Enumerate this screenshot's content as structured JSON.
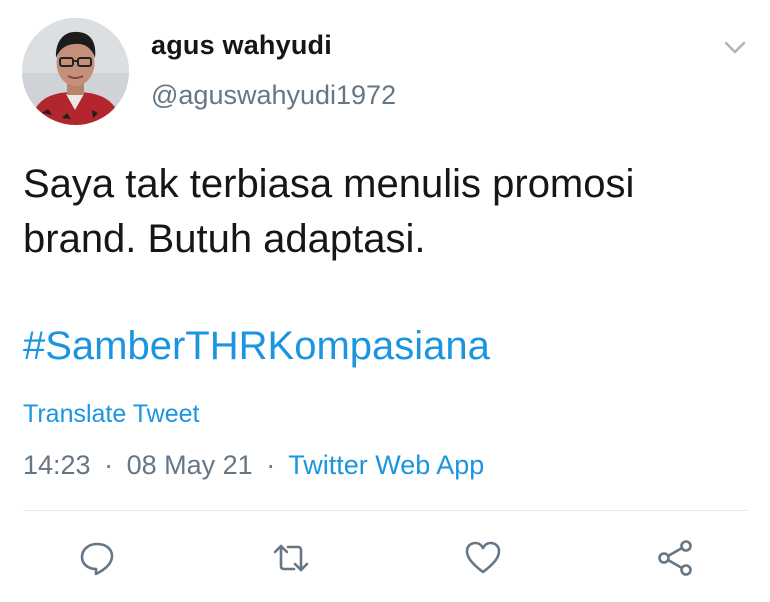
{
  "tweet": {
    "author": {
      "display_name": "agus wahyudi",
      "handle": "@aguswahyudi1972",
      "avatar_icon": "profile-photo"
    },
    "menu_icon": "chevron-down-icon",
    "body": "Saya tak terbiasa menulis promosi brand. Butuh adaptasi.",
    "hashtag": "#SamberTHRKompasiana",
    "translate_label": "Translate Tweet",
    "meta": {
      "time": "14:23",
      "separator": "·",
      "date": "08 May 21",
      "source": "Twitter Web App"
    },
    "actions": [
      {
        "name": "reply",
        "icon": "reply-icon"
      },
      {
        "name": "retweet",
        "icon": "retweet-icon"
      },
      {
        "name": "like",
        "icon": "heart-icon"
      },
      {
        "name": "share",
        "icon": "share-icon"
      }
    ]
  },
  "colors": {
    "text": "#14171a",
    "secondary": "#657786",
    "link": "#1b95e0",
    "divider": "#e1e8ed"
  }
}
